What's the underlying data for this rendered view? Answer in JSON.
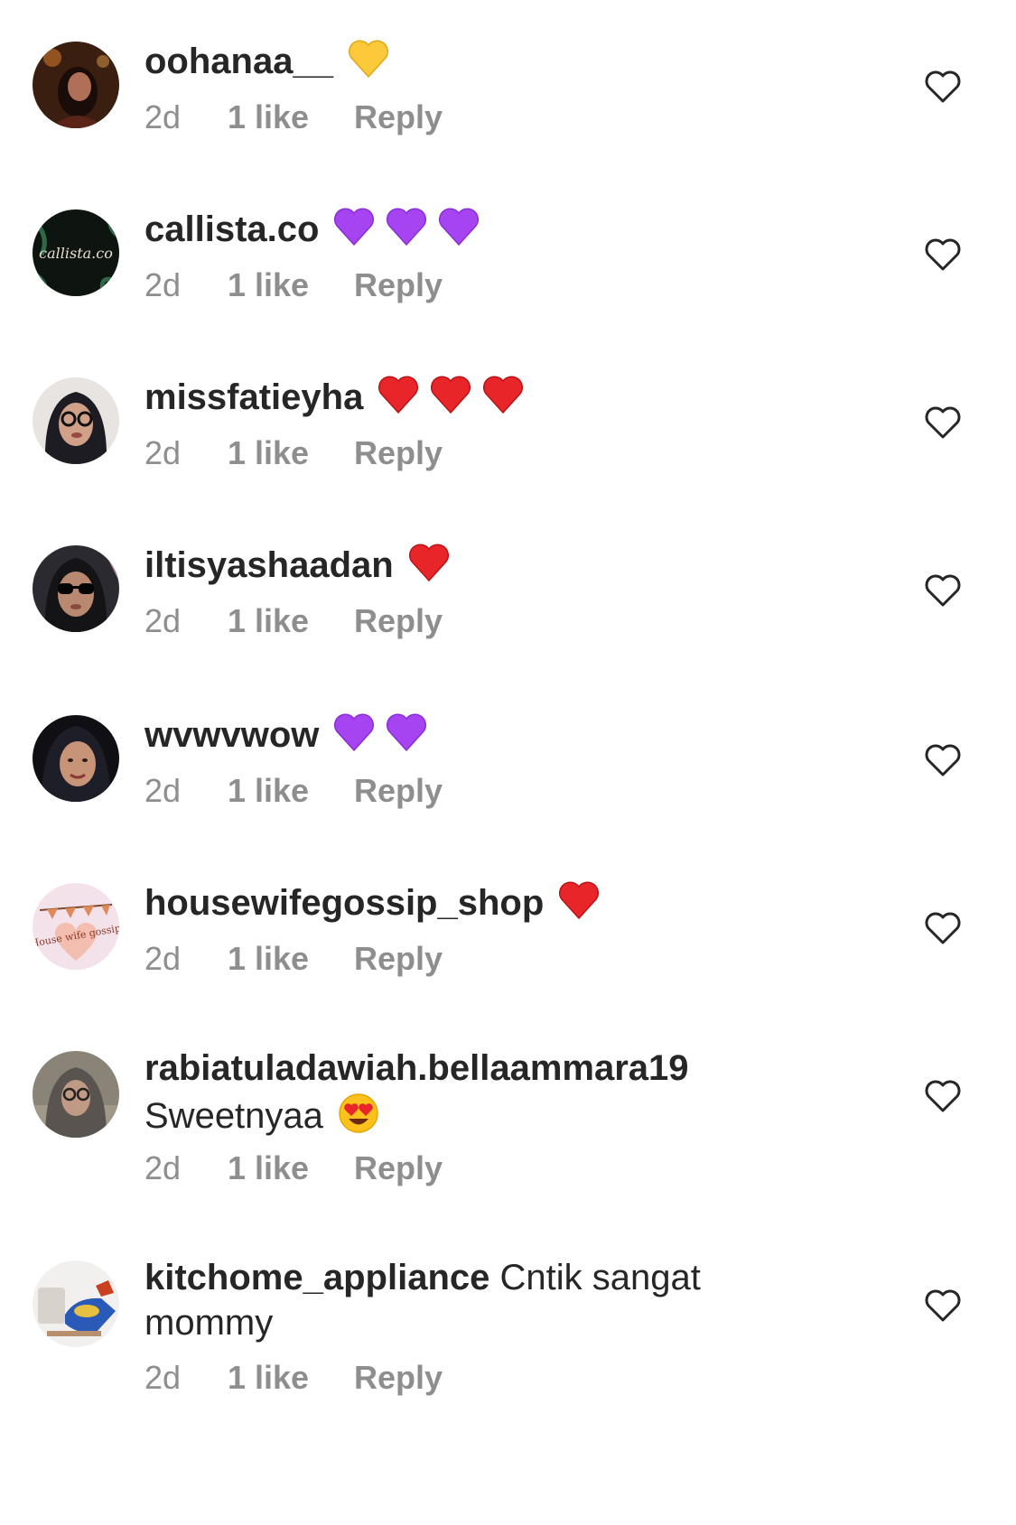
{
  "colors": {
    "text": "#262626",
    "meta": "#8e8e8e",
    "heart_outline": "#262626"
  },
  "comments": [
    {
      "username": "oohanaa__",
      "emojis": [
        "yellow-heart"
      ],
      "time": "2d",
      "likes": "1 like",
      "reply": "Reply",
      "avatar": "woman-in-dim-light-avatar"
    },
    {
      "username": "callista.co",
      "emojis": [
        "purple-heart",
        "purple-heart",
        "purple-heart"
      ],
      "time": "2d",
      "likes": "1 like",
      "reply": "Reply",
      "avatar": "callista-logo-avatar",
      "avatar_text": "callista.co"
    },
    {
      "username": "missfatieyha",
      "emojis": [
        "red-heart",
        "red-heart",
        "red-heart"
      ],
      "time": "2d",
      "likes": "1 like",
      "reply": "Reply",
      "avatar": "woman-glasses-hijab-avatar"
    },
    {
      "username": "iltisyashaadan",
      "emojis": [
        "red-heart"
      ],
      "time": "2d",
      "likes": "1 like",
      "reply": "Reply",
      "avatar": "woman-sunglasses-avatar"
    },
    {
      "username": "wvwvwow",
      "emojis": [
        "purple-heart",
        "purple-heart"
      ],
      "time": "2d",
      "likes": "1 like",
      "reply": "Reply",
      "avatar": "woman-hijab-avatar"
    },
    {
      "username": "housewifegossip_shop",
      "emojis": [
        "red-heart"
      ],
      "time": "2d",
      "likes": "1 like",
      "reply": "Reply",
      "avatar": "housewife-gossip-logo-avatar",
      "avatar_text": "House wife gossip"
    },
    {
      "username": "rabiatuladawiah.bellaammara19",
      "text": "Sweetnyaa",
      "emojis": [
        "heart-eyes-face"
      ],
      "time": "2d",
      "likes": "1 like",
      "reply": "Reply",
      "avatar": "woman-hijab-glasses-avatar"
    },
    {
      "username": "kitchome_appliance",
      "text": "Cntik sangat mommy",
      "emojis": [],
      "time": "2d",
      "likes": "1 like",
      "reply": "Reply",
      "avatar": "toaster-appliance-avatar"
    }
  ]
}
